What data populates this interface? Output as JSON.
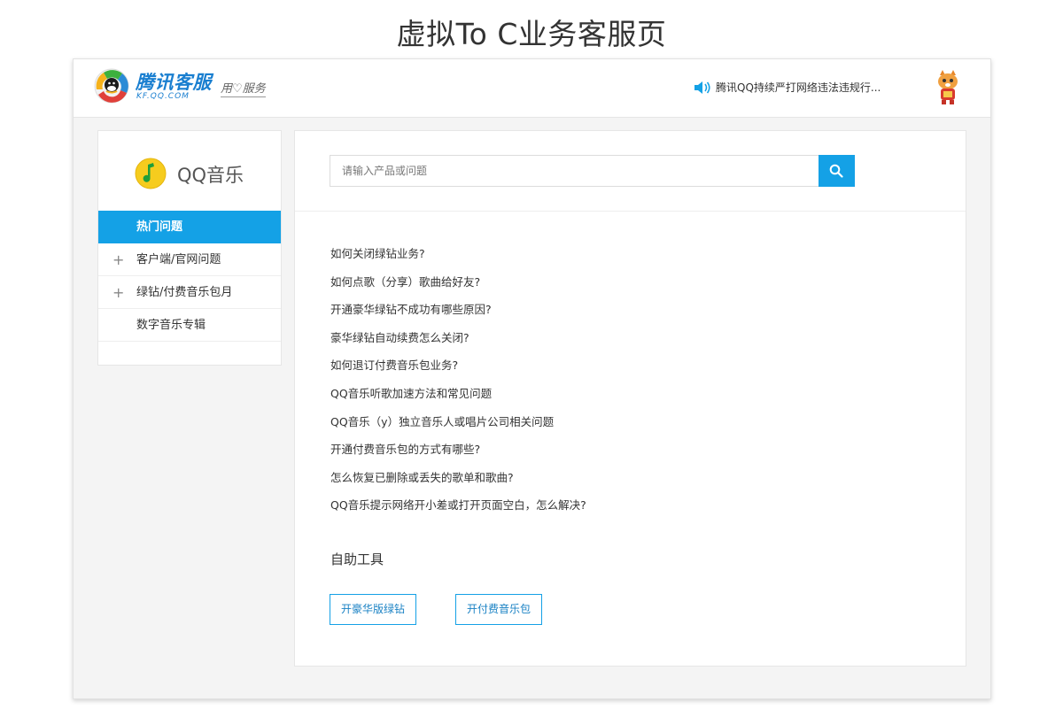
{
  "page_title": "虚拟To C业务客服页",
  "header": {
    "brand_name": "腾讯客服",
    "brand_domain": "KF.QQ.COM",
    "slogan": "用♡服务",
    "notice": "腾讯QQ持续严打网络违法违规行...",
    "icons": [
      "tencent-logo-icon",
      "speaker-icon",
      "mascot-icon"
    ]
  },
  "sidebar": {
    "product_name": "QQ音乐",
    "product_icon": "qq-music-icon",
    "items": [
      {
        "label": "热门问题",
        "active": true,
        "expandable": false
      },
      {
        "label": "客户端/官网问题",
        "active": false,
        "expandable": true
      },
      {
        "label": "绿钻/付费音乐包月",
        "active": false,
        "expandable": true
      },
      {
        "label": "数字音乐专辑",
        "active": false,
        "expandable": false
      }
    ]
  },
  "search": {
    "placeholder": "请输入产品或问题",
    "value": "",
    "button_icon": "search-icon"
  },
  "faq": [
    "如何关闭绿钻业务?",
    "如何点歌（分享）歌曲给好友?",
    "开通豪华绿钻不成功有哪些原因?",
    "豪华绿钻自动续费怎么关闭?",
    "如何退订付费音乐包业务?",
    "QQ音乐听歌加速方法和常见问题",
    "QQ音乐（y）独立音乐人或唱片公司相关问题",
    "开通付费音乐包的方式有哪些?",
    "怎么恢复已删除或丢失的歌单和歌曲?",
    "QQ音乐提示网络开小差或打开页面空白，怎么解决?"
  ],
  "tools": {
    "title": "自助工具",
    "buttons": [
      "开豪华版绿钻",
      "开付费音乐包"
    ]
  },
  "colors": {
    "accent": "#14a1e6",
    "brand": "#1a7fd0",
    "background": "#f4f4f4"
  }
}
